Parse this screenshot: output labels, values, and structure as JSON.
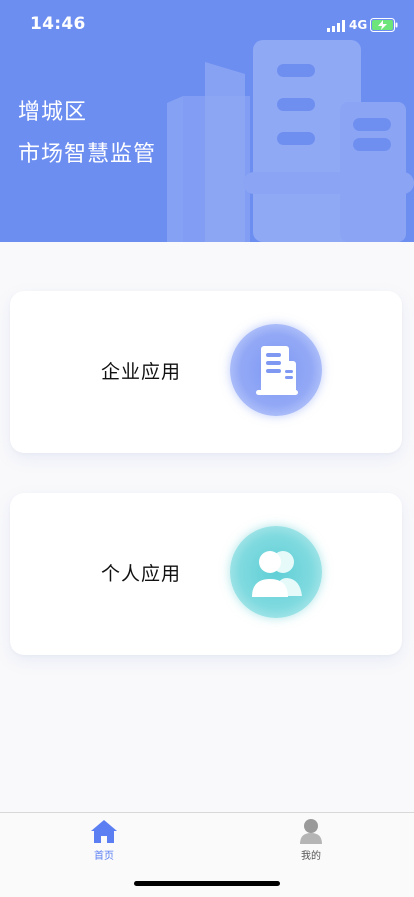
{
  "status_bar": {
    "time": "14:46",
    "network": "4G",
    "icons": [
      "cellular-signal-icon",
      "battery-charging-icon"
    ]
  },
  "header": {
    "title_line1": "增城区",
    "title_line2": "市场智慧监管",
    "background_color": "#6d8ef1",
    "illustration": "building-illustration"
  },
  "cards": [
    {
      "label": "企业应用",
      "icon": "building-icon",
      "icon_color": "#8ba2f5"
    },
    {
      "label": "个人应用",
      "icon": "users-icon",
      "icon_color": "#6fd4da"
    }
  ],
  "tabbar": {
    "items": [
      {
        "label": "首页",
        "icon": "home-icon",
        "active": true,
        "color": "#5b7ff2"
      },
      {
        "label": "我的",
        "icon": "user-icon",
        "active": false,
        "color": "#555555"
      }
    ]
  }
}
